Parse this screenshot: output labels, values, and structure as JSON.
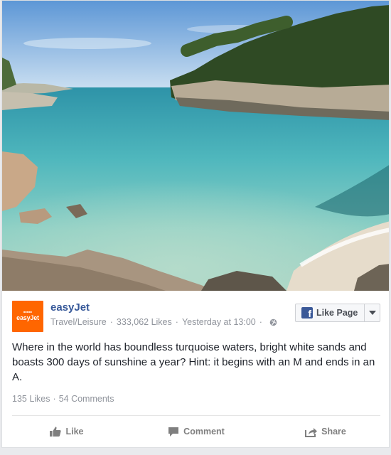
{
  "post": {
    "page_name": "easyJet",
    "category": "Travel/Leisure",
    "likes_count": "333,062 Likes",
    "timestamp": "Yesterday at 13:00",
    "logo_text": "easyJet",
    "text": "Where in the world has boundless turquoise waters, bright white sands and boasts 300 days of sunshine a year? Hint: it begins with an M and ends in an A.",
    "reactions": "135 Likes",
    "comments": "54 Comments"
  },
  "like_page_button": {
    "label": "Like Page"
  },
  "actions": {
    "like": "Like",
    "comment": "Comment",
    "share": "Share"
  },
  "colors": {
    "brand_orange": "#ff6600",
    "facebook_blue": "#3b5998",
    "link_blue": "#365899",
    "muted_gray": "#90949c"
  },
  "icons": [
    "globe-icon",
    "facebook-icon",
    "chevron-down-icon",
    "thumbs-up-icon",
    "comment-icon",
    "share-icon"
  ]
}
